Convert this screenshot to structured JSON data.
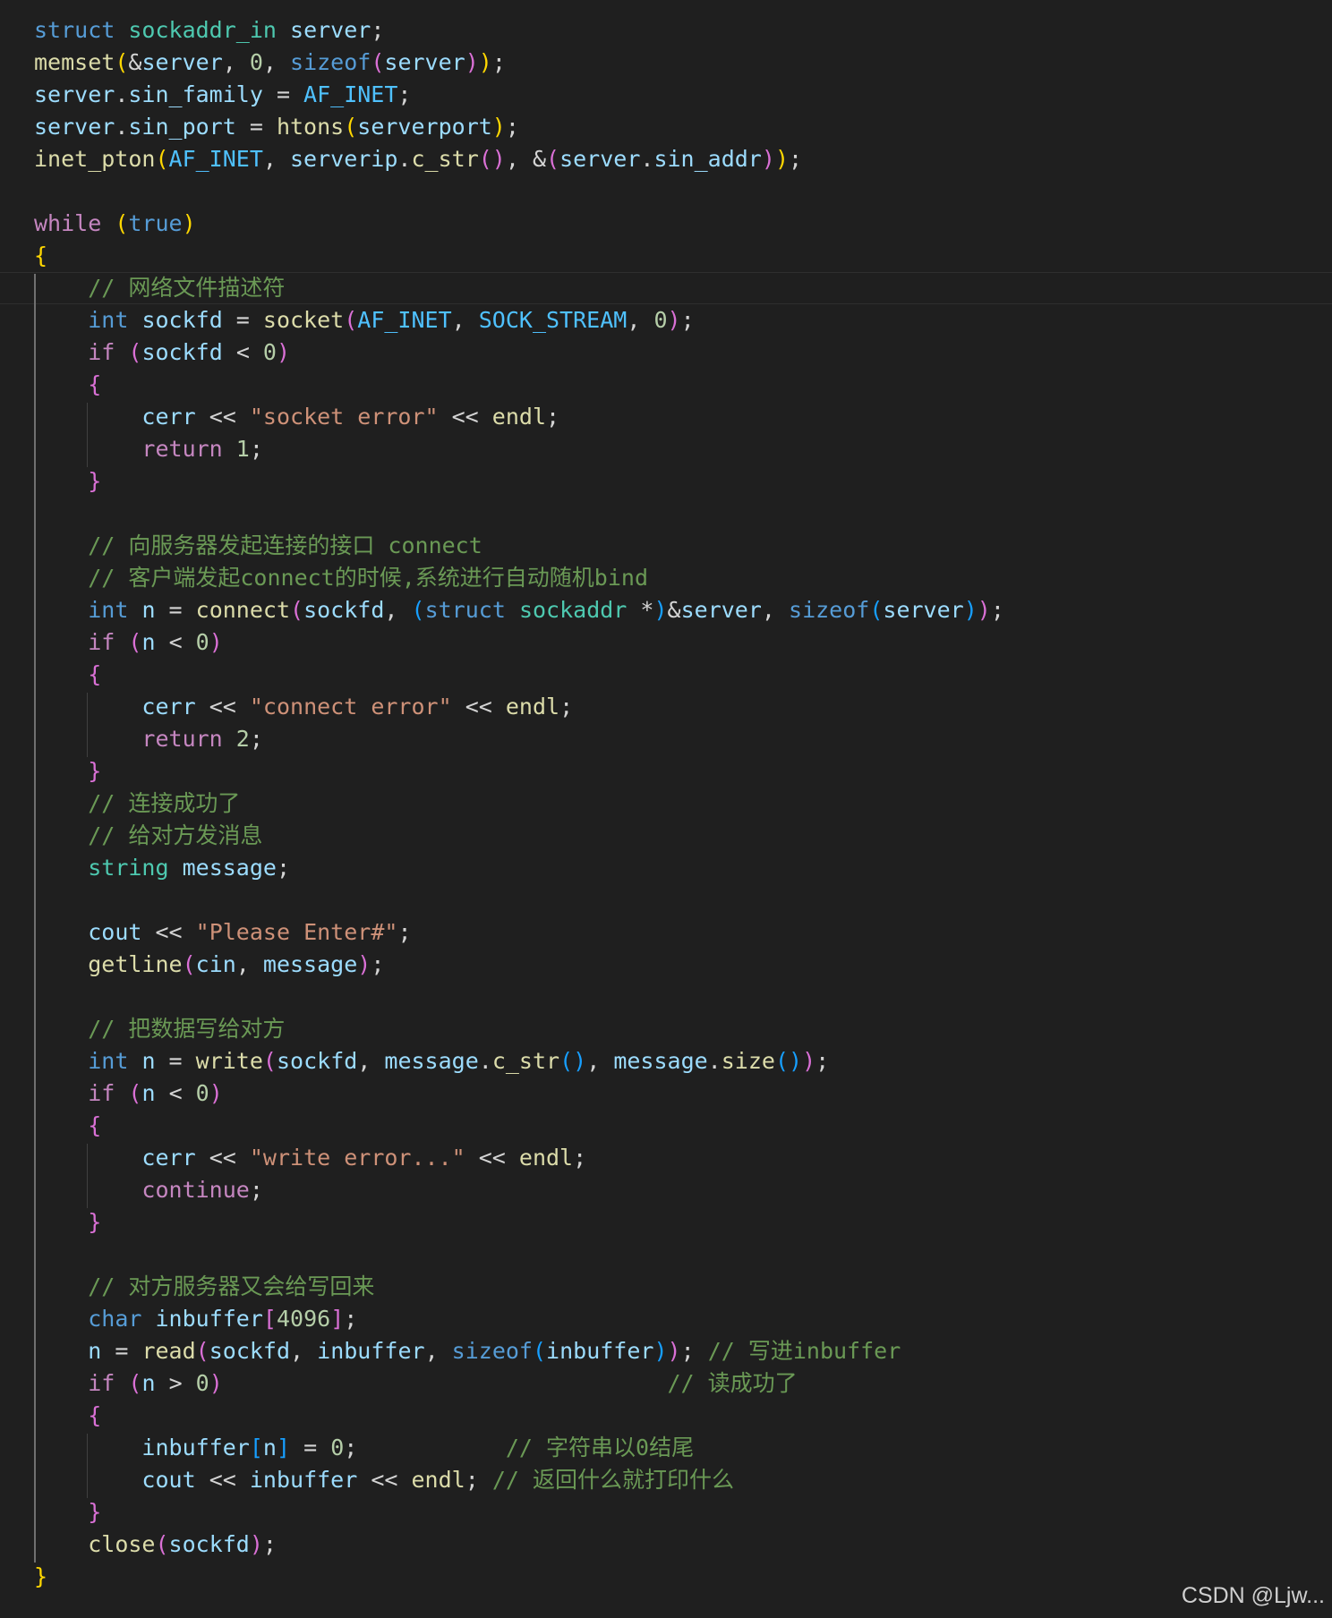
{
  "editor": {
    "language": "cpp",
    "theme": "dark",
    "colors": {
      "background": "#1f1f1f",
      "keyword": "#569cd6",
      "control": "#c586c0",
      "type": "#4ec9b0",
      "function": "#dcdcaa",
      "variable": "#9cdcfe",
      "constant": "#4fc1ff",
      "number": "#b5cea8",
      "string": "#ce9178",
      "comment": "#6a9955",
      "bracket_1": "#ffd700",
      "bracket_2": "#da70d6",
      "bracket_3": "#179fff"
    },
    "lines": [
      [
        [
          "kw",
          "struct"
        ],
        [
          "pun",
          " "
        ],
        [
          "type",
          "sockaddr_in"
        ],
        [
          "pun",
          " "
        ],
        [
          "var",
          "server"
        ],
        [
          "pun",
          ";"
        ]
      ],
      [
        [
          "fn",
          "memset"
        ],
        [
          "p1",
          "("
        ],
        [
          "pun",
          "&"
        ],
        [
          "var",
          "server"
        ],
        [
          "pun",
          ", "
        ],
        [
          "num",
          "0"
        ],
        [
          "pun",
          ", "
        ],
        [
          "kw",
          "sizeof"
        ],
        [
          "p2",
          "("
        ],
        [
          "var",
          "server"
        ],
        [
          "p2",
          ")"
        ],
        [
          "p1",
          ")"
        ],
        [
          "pun",
          ";"
        ]
      ],
      [
        [
          "var",
          "server"
        ],
        [
          "pun",
          "."
        ],
        [
          "var",
          "sin_family"
        ],
        [
          "pun",
          " = "
        ],
        [
          "const",
          "AF_INET"
        ],
        [
          "pun",
          ";"
        ]
      ],
      [
        [
          "var",
          "server"
        ],
        [
          "pun",
          "."
        ],
        [
          "var",
          "sin_port"
        ],
        [
          "pun",
          " = "
        ],
        [
          "fn",
          "htons"
        ],
        [
          "p1",
          "("
        ],
        [
          "var",
          "serverport"
        ],
        [
          "p1",
          ")"
        ],
        [
          "pun",
          ";"
        ]
      ],
      [
        [
          "fn",
          "inet_pton"
        ],
        [
          "p1",
          "("
        ],
        [
          "const",
          "AF_INET"
        ],
        [
          "pun",
          ", "
        ],
        [
          "var",
          "serverip"
        ],
        [
          "pun",
          "."
        ],
        [
          "fn",
          "c_str"
        ],
        [
          "p2",
          "()"
        ],
        [
          "pun",
          ", &"
        ],
        [
          "p2",
          "("
        ],
        [
          "var",
          "server"
        ],
        [
          "pun",
          "."
        ],
        [
          "var",
          "sin_addr"
        ],
        [
          "p2",
          ")"
        ],
        [
          "p1",
          ")"
        ],
        [
          "pun",
          ";"
        ]
      ],
      [],
      [
        [
          "ctl",
          "while"
        ],
        [
          "pun",
          " "
        ],
        [
          "p1",
          "("
        ],
        [
          "kw",
          "true"
        ],
        [
          "p1",
          ")"
        ]
      ],
      [
        [
          "p1",
          "{"
        ]
      ],
      [
        [
          "pun",
          "    "
        ],
        [
          "cmt",
          "// 网络文件描述符"
        ]
      ],
      [
        [
          "pun",
          "    "
        ],
        [
          "kw",
          "int"
        ],
        [
          "pun",
          " "
        ],
        [
          "var",
          "sockfd"
        ],
        [
          "pun",
          " = "
        ],
        [
          "fn",
          "socket"
        ],
        [
          "p2",
          "("
        ],
        [
          "const",
          "AF_INET"
        ],
        [
          "pun",
          ", "
        ],
        [
          "const",
          "SOCK_STREAM"
        ],
        [
          "pun",
          ", "
        ],
        [
          "num",
          "0"
        ],
        [
          "p2",
          ")"
        ],
        [
          "pun",
          ";"
        ]
      ],
      [
        [
          "pun",
          "    "
        ],
        [
          "ctl",
          "if"
        ],
        [
          "pun",
          " "
        ],
        [
          "p2",
          "("
        ],
        [
          "var",
          "sockfd"
        ],
        [
          "pun",
          " < "
        ],
        [
          "num",
          "0"
        ],
        [
          "p2",
          ")"
        ]
      ],
      [
        [
          "pun",
          "    "
        ],
        [
          "p2",
          "{"
        ]
      ],
      [
        [
          "pun",
          "        "
        ],
        [
          "var",
          "cerr"
        ],
        [
          "pun",
          " << "
        ],
        [
          "str",
          "\"socket error\""
        ],
        [
          "pun",
          " << "
        ],
        [
          "fn",
          "endl"
        ],
        [
          "pun",
          ";"
        ]
      ],
      [
        [
          "pun",
          "        "
        ],
        [
          "ctl",
          "return"
        ],
        [
          "pun",
          " "
        ],
        [
          "num",
          "1"
        ],
        [
          "pun",
          ";"
        ]
      ],
      [
        [
          "pun",
          "    "
        ],
        [
          "p2",
          "}"
        ]
      ],
      [],
      [
        [
          "pun",
          "    "
        ],
        [
          "cmt",
          "// 向服务器发起连接的接口 connect"
        ]
      ],
      [
        [
          "pun",
          "    "
        ],
        [
          "cmt",
          "// 客户端发起connect的时候,系统进行自动随机bind"
        ]
      ],
      [
        [
          "pun",
          "    "
        ],
        [
          "kw",
          "int"
        ],
        [
          "pun",
          " "
        ],
        [
          "var",
          "n"
        ],
        [
          "pun",
          " = "
        ],
        [
          "fn",
          "connect"
        ],
        [
          "p2",
          "("
        ],
        [
          "var",
          "sockfd"
        ],
        [
          "pun",
          ", "
        ],
        [
          "p3",
          "("
        ],
        [
          "kw",
          "struct"
        ],
        [
          "pun",
          " "
        ],
        [
          "type",
          "sockaddr"
        ],
        [
          "pun",
          " *"
        ],
        [
          "p3",
          ")"
        ],
        [
          "pun",
          "&"
        ],
        [
          "var",
          "server"
        ],
        [
          "pun",
          ", "
        ],
        [
          "kw",
          "sizeof"
        ],
        [
          "p3",
          "("
        ],
        [
          "var",
          "server"
        ],
        [
          "p3",
          ")"
        ],
        [
          "p2",
          ")"
        ],
        [
          "pun",
          ";"
        ]
      ],
      [
        [
          "pun",
          "    "
        ],
        [
          "ctl",
          "if"
        ],
        [
          "pun",
          " "
        ],
        [
          "p2",
          "("
        ],
        [
          "var",
          "n"
        ],
        [
          "pun",
          " < "
        ],
        [
          "num",
          "0"
        ],
        [
          "p2",
          ")"
        ]
      ],
      [
        [
          "pun",
          "    "
        ],
        [
          "p2",
          "{"
        ]
      ],
      [
        [
          "pun",
          "        "
        ],
        [
          "var",
          "cerr"
        ],
        [
          "pun",
          " << "
        ],
        [
          "str",
          "\"connect error\""
        ],
        [
          "pun",
          " << "
        ],
        [
          "fn",
          "endl"
        ],
        [
          "pun",
          ";"
        ]
      ],
      [
        [
          "pun",
          "        "
        ],
        [
          "ctl",
          "return"
        ],
        [
          "pun",
          " "
        ],
        [
          "num",
          "2"
        ],
        [
          "pun",
          ";"
        ]
      ],
      [
        [
          "pun",
          "    "
        ],
        [
          "p2",
          "}"
        ]
      ],
      [
        [
          "pun",
          "    "
        ],
        [
          "cmt",
          "// 连接成功了"
        ]
      ],
      [
        [
          "pun",
          "    "
        ],
        [
          "cmt",
          "// 给对方发消息"
        ]
      ],
      [
        [
          "pun",
          "    "
        ],
        [
          "type",
          "string"
        ],
        [
          "pun",
          " "
        ],
        [
          "var",
          "message"
        ],
        [
          "pun",
          ";"
        ]
      ],
      [],
      [
        [
          "pun",
          "    "
        ],
        [
          "var",
          "cout"
        ],
        [
          "pun",
          " << "
        ],
        [
          "str",
          "\"Please Enter#\""
        ],
        [
          "pun",
          ";"
        ]
      ],
      [
        [
          "pun",
          "    "
        ],
        [
          "fn",
          "getline"
        ],
        [
          "p2",
          "("
        ],
        [
          "var",
          "cin"
        ],
        [
          "pun",
          ", "
        ],
        [
          "var",
          "message"
        ],
        [
          "p2",
          ")"
        ],
        [
          "pun",
          ";"
        ]
      ],
      [],
      [
        [
          "pun",
          "    "
        ],
        [
          "cmt",
          "// 把数据写给对方"
        ]
      ],
      [
        [
          "pun",
          "    "
        ],
        [
          "kw",
          "int"
        ],
        [
          "pun",
          " "
        ],
        [
          "var",
          "n"
        ],
        [
          "pun",
          " = "
        ],
        [
          "fn",
          "write"
        ],
        [
          "p2",
          "("
        ],
        [
          "var",
          "sockfd"
        ],
        [
          "pun",
          ", "
        ],
        [
          "var",
          "message"
        ],
        [
          "pun",
          "."
        ],
        [
          "fn",
          "c_str"
        ],
        [
          "p3",
          "()"
        ],
        [
          "pun",
          ", "
        ],
        [
          "var",
          "message"
        ],
        [
          "pun",
          "."
        ],
        [
          "fn",
          "size"
        ],
        [
          "p3",
          "()"
        ],
        [
          "p2",
          ")"
        ],
        [
          "pun",
          ";"
        ]
      ],
      [
        [
          "pun",
          "    "
        ],
        [
          "ctl",
          "if"
        ],
        [
          "pun",
          " "
        ],
        [
          "p2",
          "("
        ],
        [
          "var",
          "n"
        ],
        [
          "pun",
          " < "
        ],
        [
          "num",
          "0"
        ],
        [
          "p2",
          ")"
        ]
      ],
      [
        [
          "pun",
          "    "
        ],
        [
          "p2",
          "{"
        ]
      ],
      [
        [
          "pun",
          "        "
        ],
        [
          "var",
          "cerr"
        ],
        [
          "pun",
          " << "
        ],
        [
          "str",
          "\"write error...\""
        ],
        [
          "pun",
          " << "
        ],
        [
          "fn",
          "endl"
        ],
        [
          "pun",
          ";"
        ]
      ],
      [
        [
          "pun",
          "        "
        ],
        [
          "ctl",
          "continue"
        ],
        [
          "pun",
          ";"
        ]
      ],
      [
        [
          "pun",
          "    "
        ],
        [
          "p2",
          "}"
        ]
      ],
      [],
      [
        [
          "pun",
          "    "
        ],
        [
          "cmt",
          "// 对方服务器又会给写回来"
        ]
      ],
      [
        [
          "pun",
          "    "
        ],
        [
          "kw",
          "char"
        ],
        [
          "pun",
          " "
        ],
        [
          "var",
          "inbuffer"
        ],
        [
          "p2",
          "["
        ],
        [
          "num",
          "4096"
        ],
        [
          "p2",
          "]"
        ],
        [
          "pun",
          ";"
        ]
      ],
      [
        [
          "pun",
          "    "
        ],
        [
          "var",
          "n"
        ],
        [
          "pun",
          " = "
        ],
        [
          "fn",
          "read"
        ],
        [
          "p2",
          "("
        ],
        [
          "var",
          "sockfd"
        ],
        [
          "pun",
          ", "
        ],
        [
          "var",
          "inbuffer"
        ],
        [
          "pun",
          ", "
        ],
        [
          "kw",
          "sizeof"
        ],
        [
          "p3",
          "("
        ],
        [
          "var",
          "inbuffer"
        ],
        [
          "p3",
          ")"
        ],
        [
          "p2",
          ")"
        ],
        [
          "pun",
          "; "
        ],
        [
          "cmt",
          "// 写进inbuffer"
        ]
      ],
      [
        [
          "pun",
          "    "
        ],
        [
          "ctl",
          "if"
        ],
        [
          "pun",
          " "
        ],
        [
          "p2",
          "("
        ],
        [
          "var",
          "n"
        ],
        [
          "pun",
          " > "
        ],
        [
          "num",
          "0"
        ],
        [
          "p2",
          ")"
        ],
        [
          "pun",
          "                                 "
        ],
        [
          "cmt",
          "// 读成功了"
        ]
      ],
      [
        [
          "pun",
          "    "
        ],
        [
          "p2",
          "{"
        ]
      ],
      [
        [
          "pun",
          "        "
        ],
        [
          "var",
          "inbuffer"
        ],
        [
          "p3",
          "["
        ],
        [
          "var",
          "n"
        ],
        [
          "p3",
          "]"
        ],
        [
          "pun",
          " = "
        ],
        [
          "num",
          "0"
        ],
        [
          "pun",
          ";           "
        ],
        [
          "cmt",
          "// 字符串以0结尾"
        ]
      ],
      [
        [
          "pun",
          "        "
        ],
        [
          "var",
          "cout"
        ],
        [
          "pun",
          " << "
        ],
        [
          "var",
          "inbuffer"
        ],
        [
          "pun",
          " << "
        ],
        [
          "fn",
          "endl"
        ],
        [
          "pun",
          "; "
        ],
        [
          "cmt",
          "// 返回什么就打印什么"
        ]
      ],
      [
        [
          "pun",
          "    "
        ],
        [
          "p2",
          "}"
        ]
      ],
      [
        [
          "pun",
          "    "
        ],
        [
          "fn",
          "close"
        ],
        [
          "p2",
          "("
        ],
        [
          "var",
          "sockfd"
        ],
        [
          "p2",
          ")"
        ],
        [
          "pun",
          ";"
        ]
      ],
      [
        [
          "p1",
          "}"
        ]
      ]
    ]
  },
  "watermark": "CSDN @Ljw..."
}
